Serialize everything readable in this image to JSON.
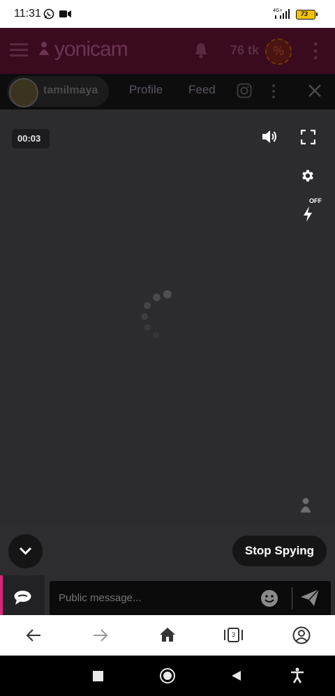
{
  "status_bar": {
    "time": "11:31",
    "signal_label": "4G+",
    "battery": "73"
  },
  "header": {
    "logo_text": "yonicam",
    "tokens": "76 tk",
    "promo_symbol": "%"
  },
  "subnav": {
    "username": "tamilmaya",
    "tab_profile": "Profile",
    "tab_feed": "Feed"
  },
  "video": {
    "timer": "00:03",
    "flash_label": "OFF"
  },
  "controls": {
    "stop_spying_label": "Stop Spying"
  },
  "chat": {
    "placeholder": "Public message..."
  },
  "browser_bar": {
    "tabs_count": "3"
  }
}
